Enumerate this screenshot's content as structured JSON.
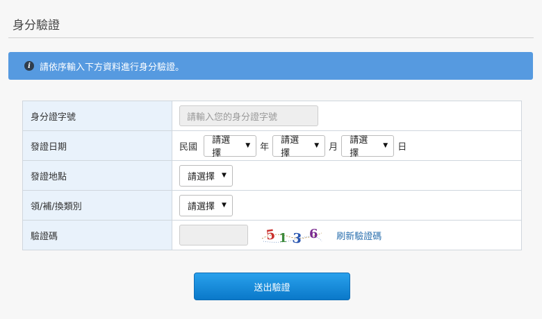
{
  "page": {
    "title": "身分驗證"
  },
  "alert": {
    "icon": "info-icon",
    "text": "請依序輸入下方資料進行身分驗證。"
  },
  "form": {
    "id_number": {
      "label": "身分證字號",
      "placeholder": "請輸入您的身分證字號"
    },
    "issue_date": {
      "label": "發證日期",
      "era": "民國",
      "year_select": "請選擇",
      "year_unit": "年",
      "month_select": "請選擇",
      "month_unit": "月",
      "day_select": "請選擇",
      "day_unit": "日"
    },
    "issue_place": {
      "label": "發證地點",
      "select": "請選擇"
    },
    "issue_type": {
      "label": "領/補/換類別",
      "select": "請選擇"
    },
    "captcha": {
      "label": "驗證碼",
      "value": "",
      "image_text": [
        "5",
        "1",
        "3",
        "6"
      ],
      "refresh_link": "刷新驗證碼"
    }
  },
  "submit": {
    "label": "送出驗證"
  },
  "colors": {
    "alert_bg": "#569ae0",
    "label_bg": "#e9f2fb",
    "button": "#1a8ddb",
    "link": "#2a6fae"
  }
}
